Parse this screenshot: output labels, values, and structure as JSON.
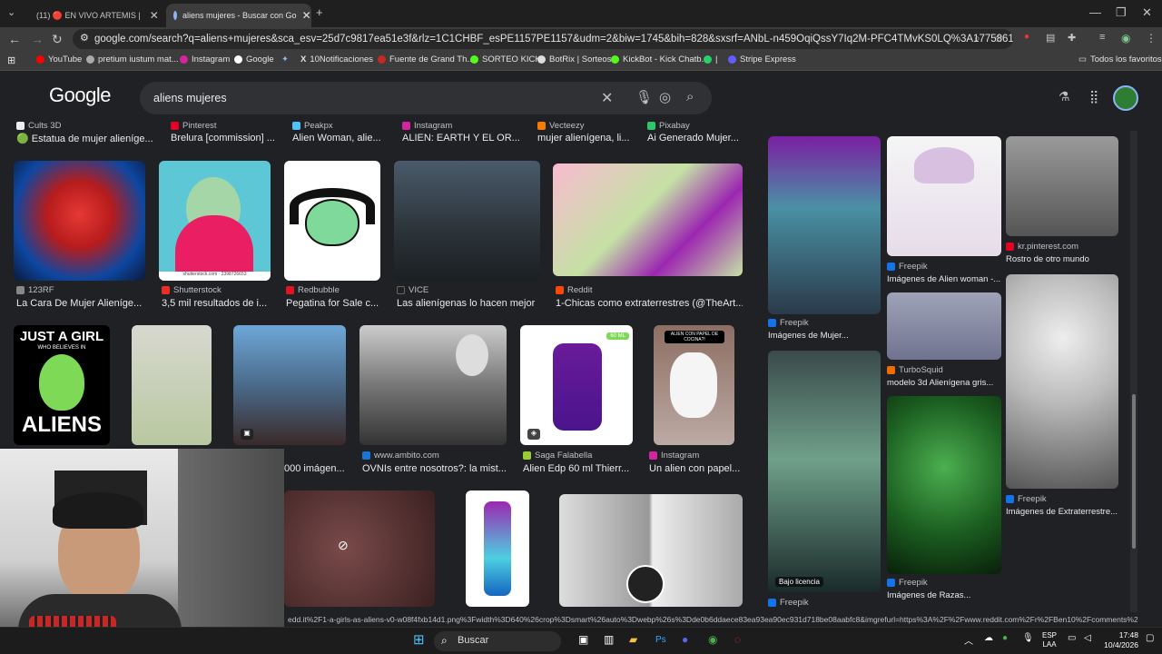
{
  "browser": {
    "tabs": [
      {
        "label": "(11) 🔴 EN VIVO ARTEMIS |"
      },
      {
        "label": "aliens mujeres - Buscar con Go"
      }
    ],
    "new_tab": "+",
    "url": "google.com/search?q=aliens+mujeres&sca_esv=25d7c9817ea51e3f&rlz=1C1CHBF_esPE1157PE1157&udm=2&biw=1745&bih=828&sxsrf=ANbL-n459OqiQssY7Iq2M-PFC4TMvKS0LQ%3A1775861257399&ei=CX7ZaduNGKyv1sQPkb...",
    "bookmarks": [
      "YouTube",
      "pretium iustum mat...",
      "Instagram",
      "Google",
      "10Notificaciones",
      "Fuente de Grand Th...",
      "SORTEO KICK",
      "BotRix | Sorteos",
      "KickBot - Kick Chatb...",
      "|",
      "Stripe Express"
    ],
    "all_bookmarks": "Todos los favoritos"
  },
  "google": {
    "logo": "Google",
    "query": "aliens mujeres"
  },
  "row0": [
    {
      "source": "Cults 3D",
      "title": "🟢 Estatua de mujer alieníge..."
    },
    {
      "source": "Pinterest",
      "title": "Brelura [commission] ..."
    },
    {
      "source": "Peakpx",
      "title": "Alien Woman, alie..."
    },
    {
      "source": "Instagram",
      "title": "ALIEN: EARTH Y EL OR..."
    },
    {
      "source": "Vecteezy",
      "title": "mujer alienígena, li..."
    },
    {
      "source": "Pixabay",
      "title": "Ai Generado Mujer..."
    }
  ],
  "row1": [
    {
      "source": "123RF",
      "title": "La Cara De Mujer Alieníge..."
    },
    {
      "source": "Shutterstock",
      "title": "3,5 mil resultados de i..."
    },
    {
      "source": "Redbubble",
      "title": "Pegatina for Sale c..."
    },
    {
      "source": "VICE",
      "title": "Las alienígenas lo hacen mejor"
    },
    {
      "source": "Reddit",
      "title": "1-Chicas como extraterrestres (@TheArt..."
    }
  ],
  "row2": [
    {
      "source": "",
      "title": "000 imágen..."
    },
    {
      "source": "www.ambito.com",
      "title": "OVNIs entre nosotros?: la mist..."
    },
    {
      "source": "Saga Falabella",
      "title": "Alien Edp 60 ml Thierr..."
    },
    {
      "source": "Instagram",
      "title": "Un alien con papel..."
    }
  ],
  "image_text": {
    "shirt_top": "JUST A GIRL",
    "shirt_mid": "WHO BELIEVES IN",
    "shirt_bottom": "ALIENS",
    "perfume_badge": "60 ML",
    "shutterstock_wm": "shutterstock.com · 2398726653",
    "paper_caption": "ALIEN CON PAPEL DE COCINA?!"
  },
  "side_panel": {
    "close": "✕",
    "items": [
      {
        "source": "Freepik",
        "title": "Imágenes de Mujer..."
      },
      {
        "source": "Freepik",
        "title": "Imágenes de Alien woman -..."
      },
      {
        "source": "kr.pinterest.com",
        "title": "Rostro de otro mundo"
      },
      {
        "source": "TurboSquid",
        "title": "modelo 3d Alienígena gris..."
      },
      {
        "source": "Freepik",
        "title": "Imágenes de Extraterrestre..."
      },
      {
        "source": "Freepik",
        "title": "Imágenes de Razas..."
      },
      {
        "source": "Freepik",
        "title": ""
      }
    ],
    "license": "Bajo licencia"
  },
  "status_url": "edd.it%2F1-a-girls-as-aliens-v0-w08f4fxb14d1.png%3Fwidth%3D640%26crop%3Dsmart%26auto%3Dwebp%26s%3Dde0b6ddaece83ea93ea90ec931d718be08aabfc8&imgrefurl=https%3A%2F%2Fwww.reddit.com%2Fr%2FBen10%2Fcomments%2F1d5yezh%2F1a_girl...",
  "taskbar": {
    "search": "Buscar",
    "lang": "ESP",
    "lang2": "LAA",
    "time": "17:48",
    "date": "10/4/2026"
  }
}
